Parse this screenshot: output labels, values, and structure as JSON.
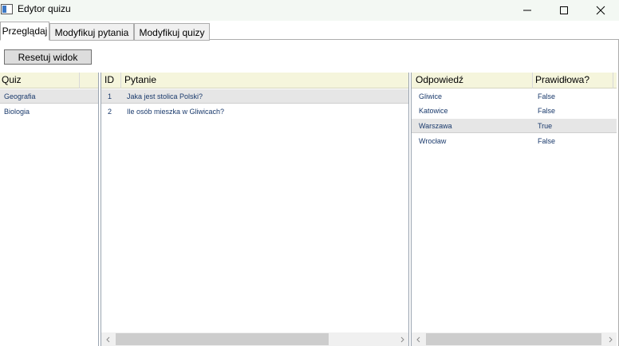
{
  "window": {
    "title": "Edytor quizu"
  },
  "tabs": [
    {
      "label": "Przeglądaj"
    },
    {
      "label": "Modyfikuj pytania"
    },
    {
      "label": "Modyfikuj quizy"
    }
  ],
  "toolbar": {
    "reset_label": "Resetuj widok"
  },
  "quiz_grid": {
    "header": "Quiz",
    "rows": [
      {
        "name": "Geografia"
      },
      {
        "name": "Biologia"
      }
    ]
  },
  "question_grid": {
    "headers": {
      "id": "ID",
      "question": "Pytanie"
    },
    "rows": [
      {
        "id": "1",
        "question": "Jaka jest stolica Polski?"
      },
      {
        "id": "2",
        "question": "Ile osób mieszka w Gliwicach?"
      }
    ]
  },
  "answer_grid": {
    "headers": {
      "answer": "Odpowiedź",
      "correct": "Prawidłowa?"
    },
    "rows": [
      {
        "answer": "Gliwice",
        "correct": "False"
      },
      {
        "answer": "Katowice",
        "correct": "False"
      },
      {
        "answer": "Warszawa",
        "correct": "True"
      },
      {
        "answer": "Wrocław",
        "correct": "False"
      }
    ]
  },
  "colors": {
    "header_bg": "#f5f5dc",
    "selected_row": "#e6e6e6",
    "cell_text": "#1a3a6c"
  },
  "icons": [
    "app-icon",
    "minimize-icon",
    "maximize-icon",
    "close-icon",
    "chevron-left-icon",
    "chevron-right-icon"
  ]
}
